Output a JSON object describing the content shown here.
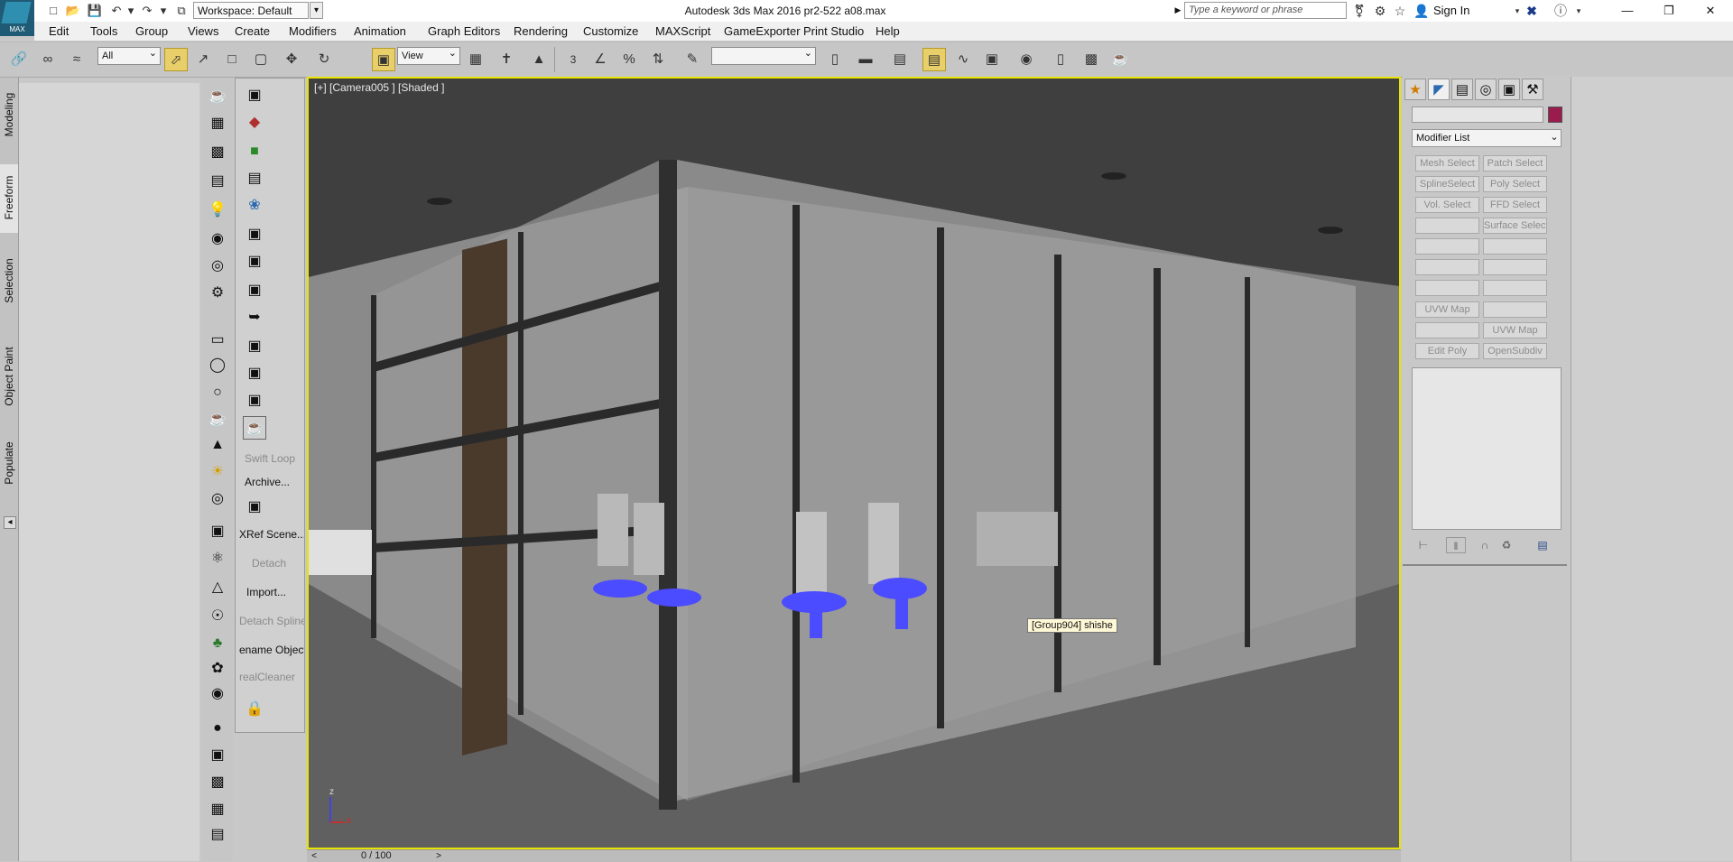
{
  "titlebar": {
    "app_logo": "MAX",
    "workspace": "Workspace: Default",
    "title": "Autodesk 3ds Max 2016     pr2-522 a08.max",
    "search_placeholder": "Type a keyword or phrase",
    "signin": "Sign In"
  },
  "menu": [
    "Edit",
    "Tools",
    "Group",
    "Views",
    "Create",
    "Modifiers",
    "Animation",
    "Graph Editors",
    "Rendering",
    "Customize",
    "MAXScript",
    "GameExporter",
    "Print Studio",
    "Help"
  ],
  "toolbar": {
    "selection_filter": "All",
    "ref_coord": "View",
    "snap_3": "3",
    "named_sel": ""
  },
  "ribbon_tabs": [
    "Modeling",
    "Freeform",
    "Selection",
    "Object Paint",
    "Populate"
  ],
  "command_buttons": {
    "swift_loop": "Swift Loop",
    "archive": "Archive...",
    "xref_scene": "XRef Scene...",
    "detach": "Detach",
    "import": "Import...",
    "detach_spline": "Detach Spline",
    "rename_objects": "ename Objects",
    "real_cleaner": "realCleaner"
  },
  "viewport": {
    "label": "[+] [Camera005 ] [Shaded ]",
    "tooltip": "[Group904] shishe",
    "axis_z": "z",
    "axis_x": "x"
  },
  "timeline": {
    "frame_counter": "0 / 100"
  },
  "command_panel": {
    "modifier_list": "Modifier List",
    "object_color": "#9a1b4e",
    "modifier_buttons": [
      {
        "label": "Mesh Select"
      },
      {
        "label": "Patch Select"
      },
      {
        "label": "SplineSelect"
      },
      {
        "label": "Poly Select"
      },
      {
        "label": "Vol. Select"
      },
      {
        "label": "FFD Select"
      },
      {
        "label": ""
      },
      {
        "label": "Surface Select"
      },
      {
        "label": ""
      },
      {
        "label": ""
      },
      {
        "label": ""
      },
      {
        "label": ""
      },
      {
        "label": ""
      },
      {
        "label": ""
      },
      {
        "label": "UVW Map"
      },
      {
        "label": ""
      },
      {
        "label": ""
      },
      {
        "label": "UVW Map"
      },
      {
        "label": "Edit Poly"
      },
      {
        "label": "OpenSubdiv"
      }
    ]
  },
  "colors": {
    "viewport_border": "#e8e400",
    "active_tool": "#e8cf6a",
    "chair_highlight": "#4b4bff"
  }
}
